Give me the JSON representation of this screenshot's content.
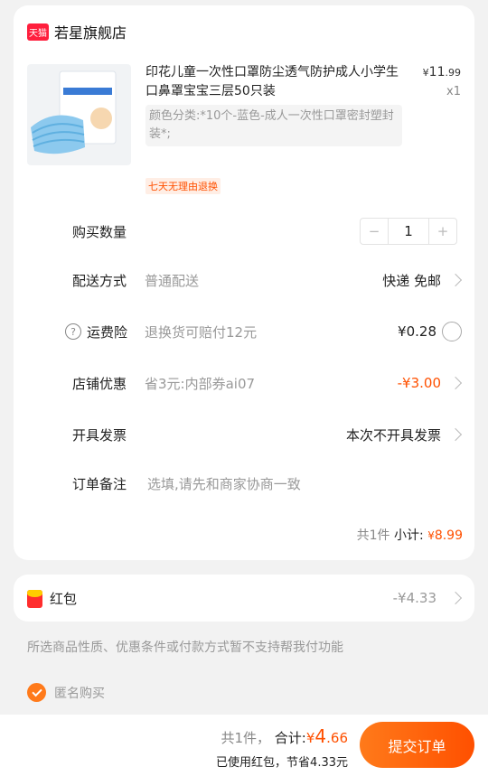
{
  "store": {
    "badge": "天猫",
    "name": "若星旗舰店"
  },
  "product": {
    "title": "印花儿童一次性口罩防尘透气防护成人小学生口鼻罩宝宝三层50只装",
    "price_symbol": "¥",
    "price_int": "11",
    "price_dec": ".99",
    "quantity_mark": "x1",
    "spec": "颜色分类:*10个-蓝色-成人一次性口罩密封塑封装*;",
    "tag": "七天无理由退换",
    "image_icon": "mask-package-image"
  },
  "quantity": {
    "label": "购买数量",
    "minus": "−",
    "value": "1",
    "plus": "+"
  },
  "delivery": {
    "label": "配送方式",
    "sub": "普通配送",
    "value": "快递 免邮"
  },
  "insurance": {
    "icon": "?",
    "label": "运费险",
    "sub": "退换货可赔付12元",
    "value": "¥0.28"
  },
  "discount": {
    "label": "店铺优惠",
    "sub": "省3元:内部券ai07",
    "value": "-¥3.00"
  },
  "invoice": {
    "label": "开具发票",
    "value": "本次不开具发票"
  },
  "note": {
    "label": "订单备注",
    "placeholder": "选填,请先和商家协商一致"
  },
  "subtotal": {
    "count": "共1件",
    "label": "小计:",
    "symbol": "¥",
    "amount": "8.99"
  },
  "red_packet": {
    "label": "红包",
    "value": "-¥4.33"
  },
  "notice": "所选商品性质、优惠条件或付款方式暂不支持帮我付功能",
  "anonymous": {
    "label": "匿名购买",
    "checked": true
  },
  "footer": {
    "count": "共1件，",
    "total_label": "合计:",
    "total_symbol": "¥",
    "total_int": "4",
    "total_dec": ".66",
    "saved": "已使用红包，节省4.33元",
    "submit": "提交订单"
  },
  "colors": {
    "accent": "#ff5000",
    "tmall": "#ff1f3d",
    "background": "#f2f2f2"
  }
}
